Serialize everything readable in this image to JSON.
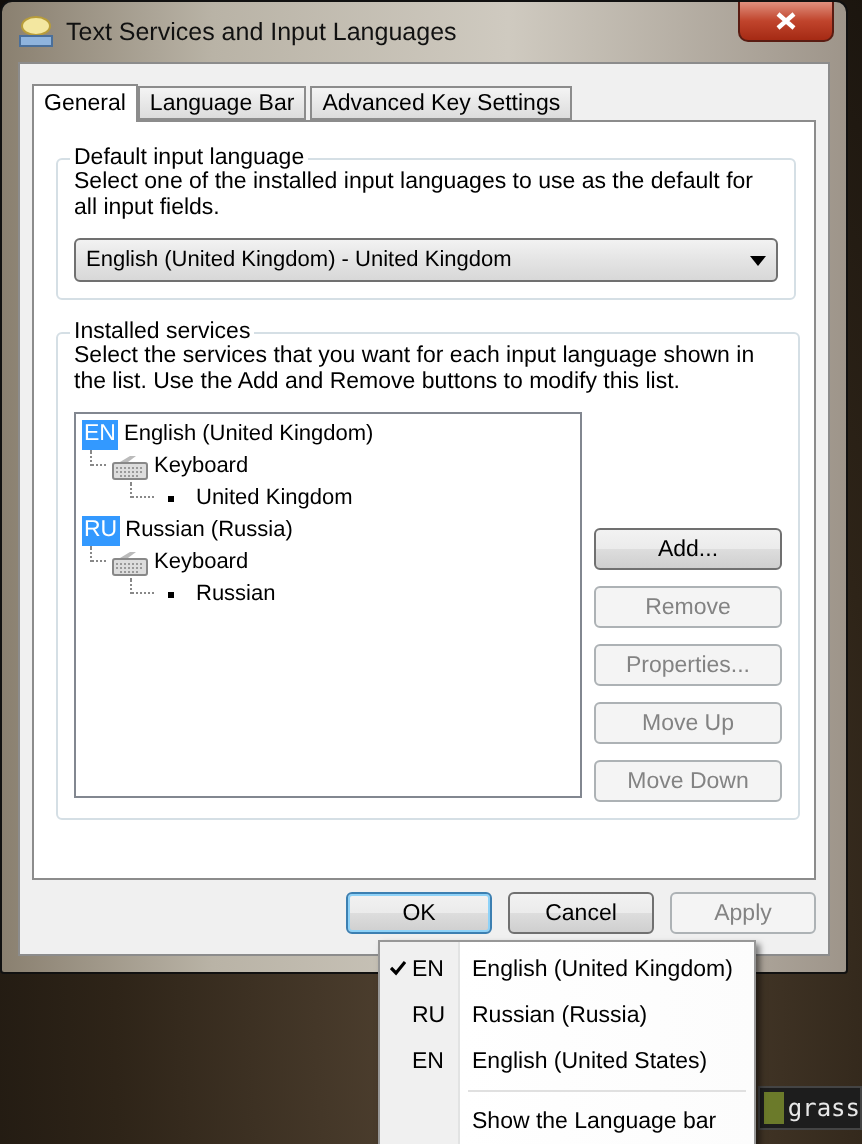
{
  "window": {
    "title": "Text Services and Input Languages"
  },
  "tabs": [
    {
      "label": "General",
      "selected": true
    },
    {
      "label": "Language Bar",
      "selected": false
    },
    {
      "label": "Advanced Key Settings",
      "selected": false
    }
  ],
  "default_input_language": {
    "heading": "Default input language",
    "description": "Select one of the installed input languages to use as the default for all input fields.",
    "value": "English (United Kingdom) - United Kingdom"
  },
  "installed_services": {
    "heading": "Installed services",
    "description": "Select the services that you want for each input language shown in the list. Use the Add and Remove buttons to modify this list.",
    "tree": [
      {
        "code": "EN",
        "label": "English (United Kingdom)",
        "children": [
          {
            "label": "Keyboard",
            "children": [
              {
                "label": "United Kingdom"
              }
            ]
          }
        ]
      },
      {
        "code": "RU",
        "label": "Russian (Russia)",
        "children": [
          {
            "label": "Keyboard",
            "children": [
              {
                "label": "Russian"
              }
            ]
          }
        ]
      }
    ],
    "buttons": [
      {
        "label": "Add...",
        "disabled": false
      },
      {
        "label": "Remove",
        "disabled": true
      },
      {
        "label": "Properties...",
        "disabled": true
      },
      {
        "label": "Move Up",
        "disabled": true
      },
      {
        "label": "Move Down",
        "disabled": true
      }
    ]
  },
  "dialog_buttons": [
    {
      "label": "OK",
      "disabled": false,
      "focused": true
    },
    {
      "label": "Cancel",
      "disabled": false,
      "focused": false
    },
    {
      "label": "Apply",
      "disabled": true,
      "focused": false
    }
  ],
  "language_menu": {
    "items": [
      {
        "kind": "language",
        "code": "EN",
        "label": "English (United Kingdom)",
        "checked": true
      },
      {
        "kind": "language",
        "code": "RU",
        "label": "Russian (Russia)",
        "checked": false
      },
      {
        "kind": "language",
        "code": "EN",
        "label": "English (United States)",
        "checked": false
      },
      {
        "kind": "separator"
      },
      {
        "kind": "command",
        "label": "Show the Language bar"
      }
    ]
  },
  "desktop_item": {
    "label": "grass"
  }
}
